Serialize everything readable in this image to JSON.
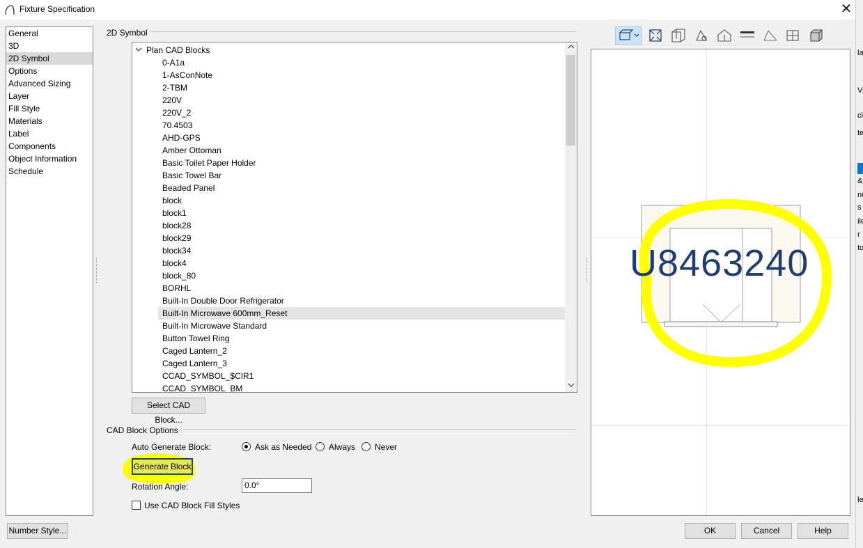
{
  "window": {
    "title": "Fixture Specification",
    "close_glyph": "✕"
  },
  "categories": [
    {
      "label": "General"
    },
    {
      "label": "3D"
    },
    {
      "label": "2D Symbol",
      "selected": true
    },
    {
      "label": "Options"
    },
    {
      "label": "Advanced Sizing"
    },
    {
      "label": "Layer"
    },
    {
      "label": "Fill Style"
    },
    {
      "label": "Materials"
    },
    {
      "label": "Label"
    },
    {
      "label": "Components"
    },
    {
      "label": "Object Information"
    },
    {
      "label": "Schedule"
    }
  ],
  "symbol_group": {
    "title": "2D Symbol"
  },
  "tree": {
    "root_label": "Plan CAD Blocks",
    "items": [
      "0-A1a",
      "1-AsConNote",
      "2-TBM",
      "220V",
      "220V_2",
      "70.4503",
      "AHD-GPS",
      "Amber Ottoman",
      "Basic Toilet Paper Holder",
      "Basic Towel Bar",
      "Beaded Panel",
      "block",
      "block1",
      "block28",
      "block29",
      "block34",
      "block4",
      "block_80",
      "BORHL",
      "Built-In Double Door Refrigerator",
      "Built-In Microwave 600mm_Reset",
      "Built-In Microwave Standard",
      "Button Towel Ring",
      "Caged Lantern_2",
      "Caged Lantern_3",
      "CCAD_SYMBOL_$CIR1",
      "CCAD_SYMBOL_BM"
    ],
    "selected_item": "Built-In Microwave 600mm_Reset"
  },
  "buttons": {
    "select_cad_block": "Select CAD Block...",
    "generate_block": "Generate Block",
    "number_style": "Number Style...",
    "ok": "OK",
    "cancel": "Cancel",
    "help": "Help"
  },
  "cad_options": {
    "title": "CAD Block Options",
    "auto_generate_label": "Auto Generate Block:",
    "radio_options": [
      "Ask as Needed",
      "Always",
      "Never"
    ],
    "selected_option": "Ask as Needed",
    "rotation_label": "Rotation Angle:",
    "rotation_value": "0.0°",
    "fill_styles_label": "Use CAD Block Fill Styles",
    "fill_styles_checked": false
  },
  "preview": {
    "overlay_text": "U8463240",
    "highlight_color": "#ffff00",
    "overlay_text_color": "#1f3d6e",
    "toolbar_icons": [
      "camera-view-icon",
      "fill-window-icon",
      "plan-view-icon",
      "elevation-view-icon",
      "perspective-view-icon",
      "floor-plan-icon",
      "wall-icon",
      "cabinet-view-icon",
      "box-view-icon"
    ]
  },
  "right_strip_fragments": [
    "la",
    "Vi",
    "ci",
    "te",
    "&",
    "no",
    "s",
    "ile",
    "r",
    "to",
    "le"
  ]
}
